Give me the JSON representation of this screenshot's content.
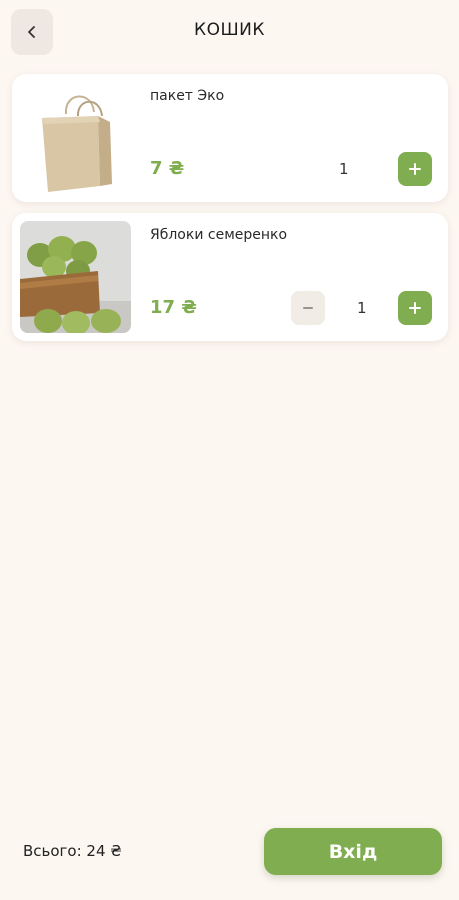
{
  "header": {
    "back_icon": "chevron-left-icon",
    "title": "КОШИК"
  },
  "cart": {
    "items": [
      {
        "name": "пакет Эко",
        "price": "7 ₴",
        "quantity": "1",
        "image": "paper-bag",
        "has_minus": false
      },
      {
        "name": "Яблоки семеренко",
        "price": "17 ₴",
        "quantity": "1",
        "image": "green-apples-basket",
        "has_minus": true
      }
    ]
  },
  "footer": {
    "total": "Всього: 24 ₴",
    "login_label": "Вхід"
  },
  "colors": {
    "background": "#fdf7f2",
    "accent_green": "#7fad4f",
    "card": "#ffffff",
    "button_muted": "#efe8e2"
  }
}
